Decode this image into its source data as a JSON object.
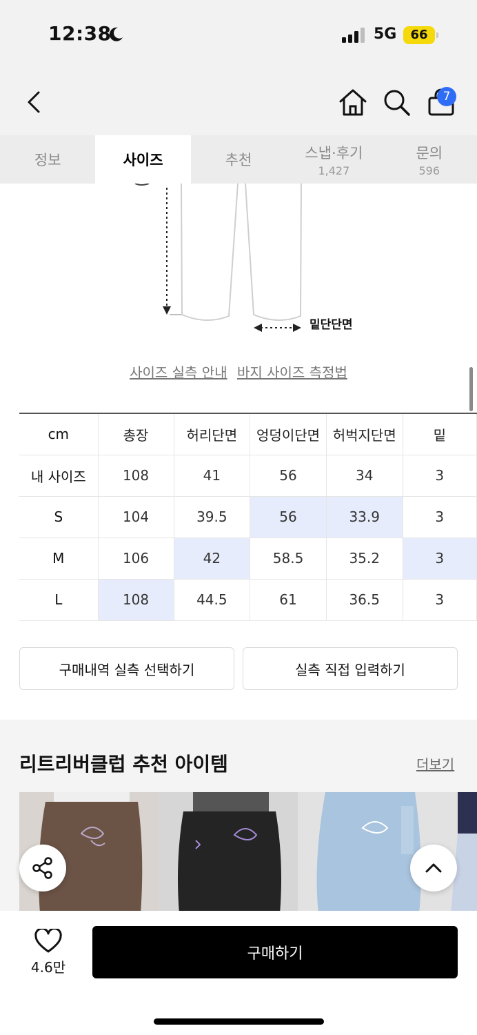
{
  "status_bar": {
    "time": "12:38",
    "network": "5G",
    "battery": "66"
  },
  "header": {
    "cart_count": "7"
  },
  "tabs": [
    {
      "label": "정보",
      "count": ""
    },
    {
      "label": "사이즈",
      "count": ""
    },
    {
      "label": "추천",
      "count": ""
    },
    {
      "label": "스냅·후기",
      "count": "1,427"
    },
    {
      "label": "문의",
      "count": "596"
    }
  ],
  "active_tab": 1,
  "diagram": {
    "hem_label": "밑단단면"
  },
  "guide_links": {
    "actual_size_guide": "사이즈 실측 안내",
    "pants_measure_guide": "바지 사이즈 측정법"
  },
  "size_table": {
    "headers": [
      "cm",
      "총장",
      "허리단면",
      "엉덩이단면",
      "허벅지단면",
      "밑"
    ],
    "rows": [
      {
        "cells": [
          "내 사이즈",
          "108",
          "41",
          "56",
          "34",
          "3"
        ],
        "highlight": []
      },
      {
        "cells": [
          "S",
          "104",
          "39.5",
          "56",
          "33.9",
          "3"
        ],
        "highlight": [
          3,
          4
        ]
      },
      {
        "cells": [
          "M",
          "106",
          "42",
          "58.5",
          "35.2",
          "3"
        ],
        "highlight": [
          2,
          5
        ]
      },
      {
        "cells": [
          "L",
          "108",
          "44.5",
          "61",
          "36.5",
          "3"
        ],
        "highlight": [
          1
        ]
      }
    ],
    "highlight_color": "#e6ecfb"
  },
  "actions": {
    "select_from_purchases": "구매내역 실측 선택하기",
    "enter_manually": "실측 직접 입력하기"
  },
  "recommended": {
    "title": "리트리버클럽 추천 아이템",
    "more_label": "더보기"
  },
  "bottom_bar": {
    "likes": "4.6만",
    "buy_label": "구매하기"
  },
  "colors": {
    "accent_badge": "#2f6df6",
    "buy_button": "#000000",
    "battery": "#f5d90a"
  }
}
